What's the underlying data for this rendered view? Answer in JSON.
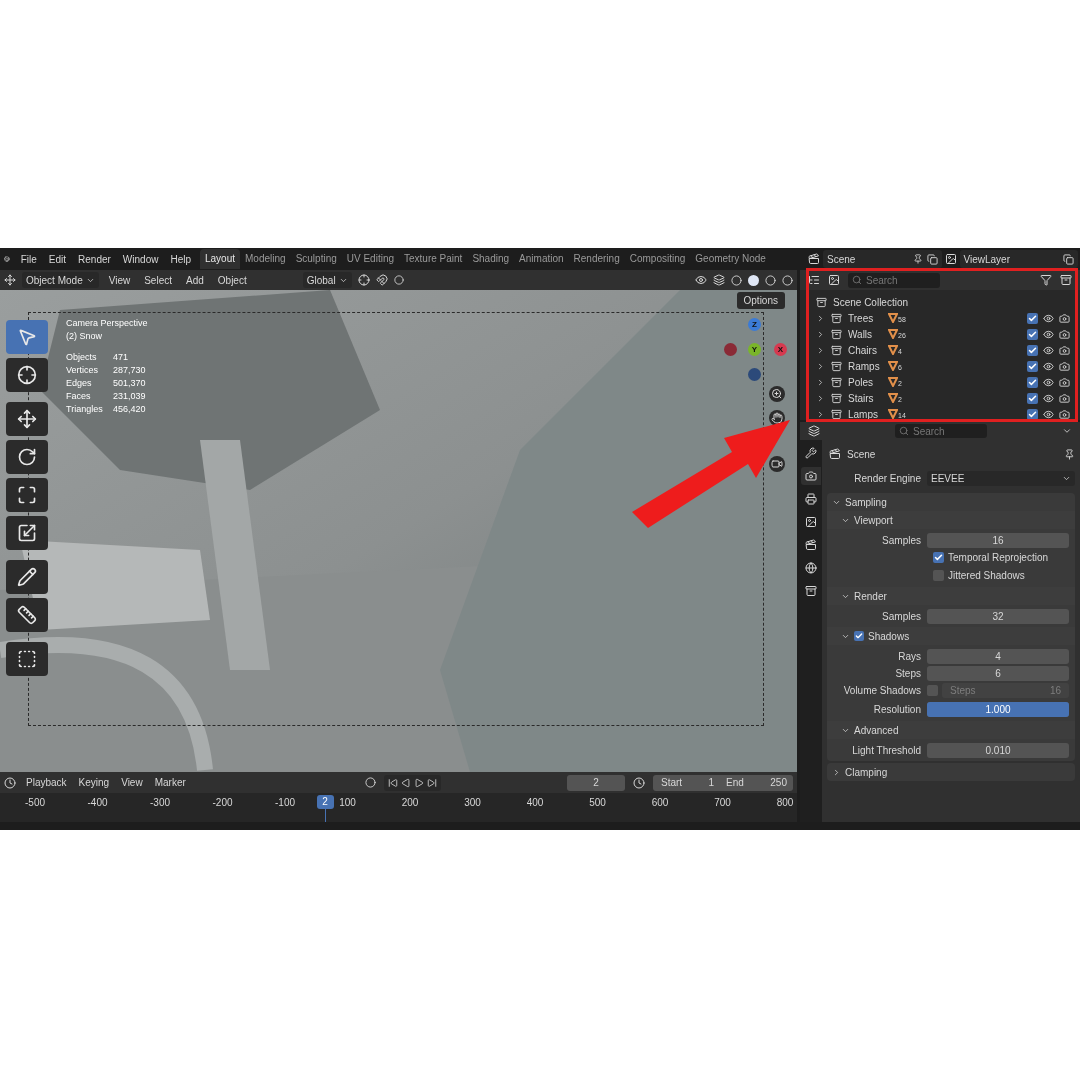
{
  "menu": [
    "File",
    "Edit",
    "Render",
    "Window",
    "Help"
  ],
  "workspaces": [
    {
      "label": "Layout",
      "selected": true
    },
    {
      "label": "Modeling",
      "selected": false
    },
    {
      "label": "Sculpting",
      "selected": false
    },
    {
      "label": "UV Editing",
      "selected": false
    },
    {
      "label": "Texture Paint",
      "selected": false
    },
    {
      "label": "Shading",
      "selected": false
    },
    {
      "label": "Animation",
      "selected": false
    },
    {
      "label": "Rendering",
      "selected": false
    },
    {
      "label": "Compositing",
      "selected": false
    },
    {
      "label": "Geometry Node",
      "selected": false
    }
  ],
  "scene": "Scene",
  "view_layer": "ViewLayer",
  "viewport_header": {
    "mode": "Object Mode",
    "menus": [
      "View",
      "Select",
      "Add",
      "Object"
    ],
    "orientation": "Global"
  },
  "viewport": {
    "options": "Options",
    "title": "Camera Perspective",
    "subtitle": "(2) Snow",
    "stats": [
      {
        "label": "Objects",
        "value": "471"
      },
      {
        "label": "Vertices",
        "value": "287,730"
      },
      {
        "label": "Edges",
        "value": "501,370"
      },
      {
        "label": "Faces",
        "value": "231,039"
      },
      {
        "label": "Triangles",
        "value": "456,420"
      }
    ],
    "axes": [
      {
        "label": "Z",
        "color": "#3b7bd6"
      },
      {
        "label": "Y",
        "color": "#7ab52a"
      },
      {
        "label": "X",
        "color": "#d6394f"
      }
    ]
  },
  "toolbar": [
    {
      "kind": "select",
      "selected": true
    },
    {
      "kind": "cursor",
      "selected": false
    },
    {
      "kind": "move",
      "selected": false
    },
    {
      "kind": "rotate",
      "selected": false
    },
    {
      "kind": "scale",
      "selected": false
    },
    {
      "kind": "transform",
      "selected": false
    },
    {
      "kind": "annotate",
      "selected": false
    },
    {
      "kind": "measure",
      "selected": false
    },
    {
      "kind": "add",
      "selected": false
    }
  ],
  "outliner": {
    "search_placeholder": "Search",
    "root": "Scene Collection",
    "collections": [
      {
        "name": "Trees",
        "count": "58",
        "checked": true
      },
      {
        "name": "Walls",
        "count": "26",
        "checked": true
      },
      {
        "name": "Chairs",
        "count": "4",
        "checked": true
      },
      {
        "name": "Ramps",
        "count": "6",
        "checked": true
      },
      {
        "name": "Poles",
        "count": "2",
        "checked": true
      },
      {
        "name": "Stairs",
        "count": "2",
        "checked": true
      },
      {
        "name": "Lamps",
        "count": "14",
        "checked": true
      }
    ]
  },
  "properties": {
    "search_placeholder": "Search",
    "context": "Scene",
    "tabs": [
      {
        "kind": "tool",
        "selected": false
      },
      {
        "kind": "render",
        "selected": true
      },
      {
        "kind": "output",
        "selected": false
      },
      {
        "kind": "view_layer",
        "selected": false
      },
      {
        "kind": "scene",
        "selected": false
      },
      {
        "kind": "world",
        "selected": false
      },
      {
        "kind": "collection",
        "selected": false
      }
    ],
    "render_engine": {
      "label": "Render Engine",
      "value": "EEVEE"
    },
    "panels": [
      {
        "title": "Sampling",
        "expanded": true,
        "subpanels": [
          {
            "title": "Viewport",
            "kind": "plain",
            "expanded": true,
            "fields": [
              {
                "kind": "number",
                "label": "Samples",
                "value": "16"
              },
              {
                "kind": "checkbox",
                "label": "Temporal Reprojection",
                "checked": true
              },
              {
                "kind": "checkbox",
                "label": "Jittered Shadows",
                "checked": false
              }
            ]
          },
          {
            "title": "Render",
            "kind": "plain",
            "expanded": true,
            "fields": [
              {
                "kind": "number",
                "label": "Samples",
                "value": "32"
              }
            ]
          },
          {
            "title": "Shadows",
            "kind": "toggle",
            "checked": true,
            "expanded": true,
            "fields": [
              {
                "kind": "number",
                "label": "Rays",
                "value": "4"
              },
              {
                "kind": "number",
                "label": "Steps",
                "value": "6"
              },
              {
                "kind": "checkbox_number",
                "label": "Volume Shadows",
                "checked": false,
                "field_label": "Steps",
                "value": "16"
              },
              {
                "kind": "slider",
                "label": "Resolution",
                "value": "1.000",
                "level": 1
              }
            ]
          },
          {
            "title": "Advanced",
            "kind": "plain",
            "expanded": true,
            "fields": [
              {
                "kind": "number",
                "label": "Light Threshold",
                "value": "0.010"
              }
            ]
          }
        ]
      },
      {
        "title": "Clamping",
        "expanded": false
      }
    ]
  },
  "timeline": {
    "menus": [
      "Playback",
      "Keying",
      "View",
      "Marker"
    ],
    "current_frame": "2",
    "start_label": "Start",
    "start": "1",
    "end_label": "End",
    "end": "250",
    "ticks": [
      "-500",
      "-400",
      "-300",
      "-200",
      "-100",
      "100",
      "200",
      "300",
      "400",
      "500",
      "600",
      "700",
      "800"
    ],
    "playhead": "2"
  }
}
